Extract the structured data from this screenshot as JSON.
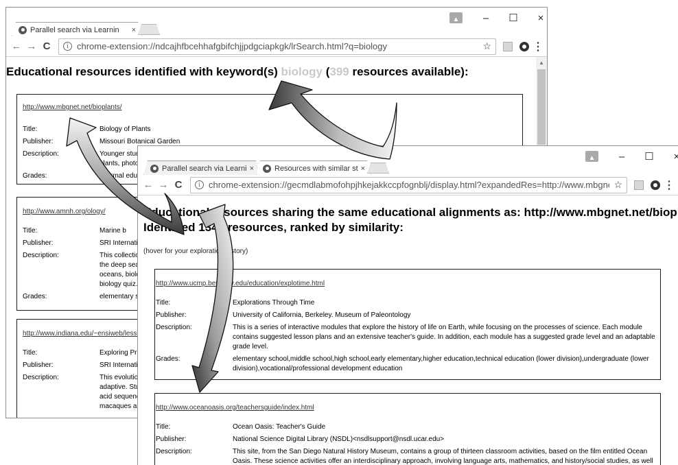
{
  "back_window": {
    "tabs": [
      {
        "label": "Parallel search via Learnin",
        "close": "×"
      }
    ],
    "url": "chrome-extension://ndcajhfbcehhafgbifchjjpdgciapkgk/lrSearch.html?q=biology",
    "heading": {
      "prefix": "Educational resources identified with keyword(s) ",
      "keyword": "biology",
      "open": " (",
      "count": "399",
      "suffix": " resources available):"
    },
    "resources": [
      {
        "url": "http://www.mbgnet.net/bioplants/",
        "fields": [
          {
            "label": "Title:",
            "value": "Biology of Plants"
          },
          {
            "label": "Publisher:",
            "value": "Missouri Botanical Garden"
          },
          {
            "label": "Description:",
            "value": "Younger stud\nplants, photo"
          },
          {
            "label": "Grades:",
            "value": "informal edu"
          }
        ]
      },
      {
        "url": "http://www.amnh.org/ology/",
        "fields": [
          {
            "label": "Title:",
            "value": "Marine b"
          },
          {
            "label": "Publisher:",
            "value": "SRI Internatio"
          },
          {
            "label": "Description:",
            "value": "This collectio\nthe deep sea\noceans, biolo\nbiology quiz."
          },
          {
            "label": "Grades:",
            "value": "elementary s"
          }
        ]
      },
      {
        "url": "http://www.indiana.edu/~ensiweb/lessi",
        "fields": [
          {
            "label": "Title:",
            "value": "Exploring Pri"
          },
          {
            "label": "Publisher:",
            "value": "SRI Internatio"
          },
          {
            "label": "Description:",
            "value": "This evolutio\nadaptive. Stu\nacid sequenc\nmacaques an"
          }
        ]
      }
    ]
  },
  "front_window": {
    "tabs": [
      {
        "label": "Parallel search via Learnin",
        "close": "×"
      },
      {
        "label": "Resources with similar st",
        "close": "×"
      }
    ],
    "url": "chrome-extension://gecmdlabmofohpjhkejakkccpfognblj/display.html?expandedRes=http://www.mbgnet.net/biopla",
    "heading_line1": "Educational resources sharing the same educational alignments as: http://www.mbgnet.net/bioplants/.",
    "heading_line2": "Identified 1345 resources, ranked by similarity:",
    "note": "(hover for your exploration history)",
    "resources": [
      {
        "url": "http://www.ucmp.berkeley.edu/education/explotime.html",
        "fields": [
          {
            "label": "Title:",
            "value": "Explorations Through Time"
          },
          {
            "label": "Publisher:",
            "value": "University of California, Berkeley. Museum of Paleontology"
          },
          {
            "label": "Description:",
            "value": "This is a series of interactive modules that explore the history of life on Earth, while focusing on the processes of science. Each module contains suggested lesson plans and an extensive teacher's guide. In addition, each module has a suggested grade level and an adaptable grade level."
          },
          {
            "label": "Grades:",
            "value": "elementary school,middle school,high school,early elementary,higher education,technical education (lower division),undergraduate (lower division),vocational/professional development education"
          }
        ]
      },
      {
        "url": "http://www.oceanoasis.org/teachersguide/index.html",
        "fields": [
          {
            "label": "Title:",
            "value": "Ocean Oasis: Teacher's Guide"
          },
          {
            "label": "Publisher:",
            "value": "National Science Digital Library (NSDL)<nsdlsupport@nsdl.ucar.edu>"
          },
          {
            "label": "Description:",
            "value": "This site, from the San Diego Natural History Museum, contains a group of thirteen classroom activities, based on the film entitled Ocean Oasis. These science activities offer an interdisciplinary approach, involving language arts, mathematics, and history/social studies, as well as"
          }
        ]
      }
    ]
  },
  "window_controls": {
    "minimize": "–",
    "maximize": "☐",
    "close": "×"
  },
  "nav": {
    "back": "←",
    "forward": "→",
    "reload": "C",
    "info": "i",
    "star": "☆",
    "menu": "⋮"
  },
  "colors": {
    "muted_text": "#c9c9c9",
    "arrow_fill_light": "#ececec",
    "arrow_fill_dark": "#3a3a3a"
  }
}
